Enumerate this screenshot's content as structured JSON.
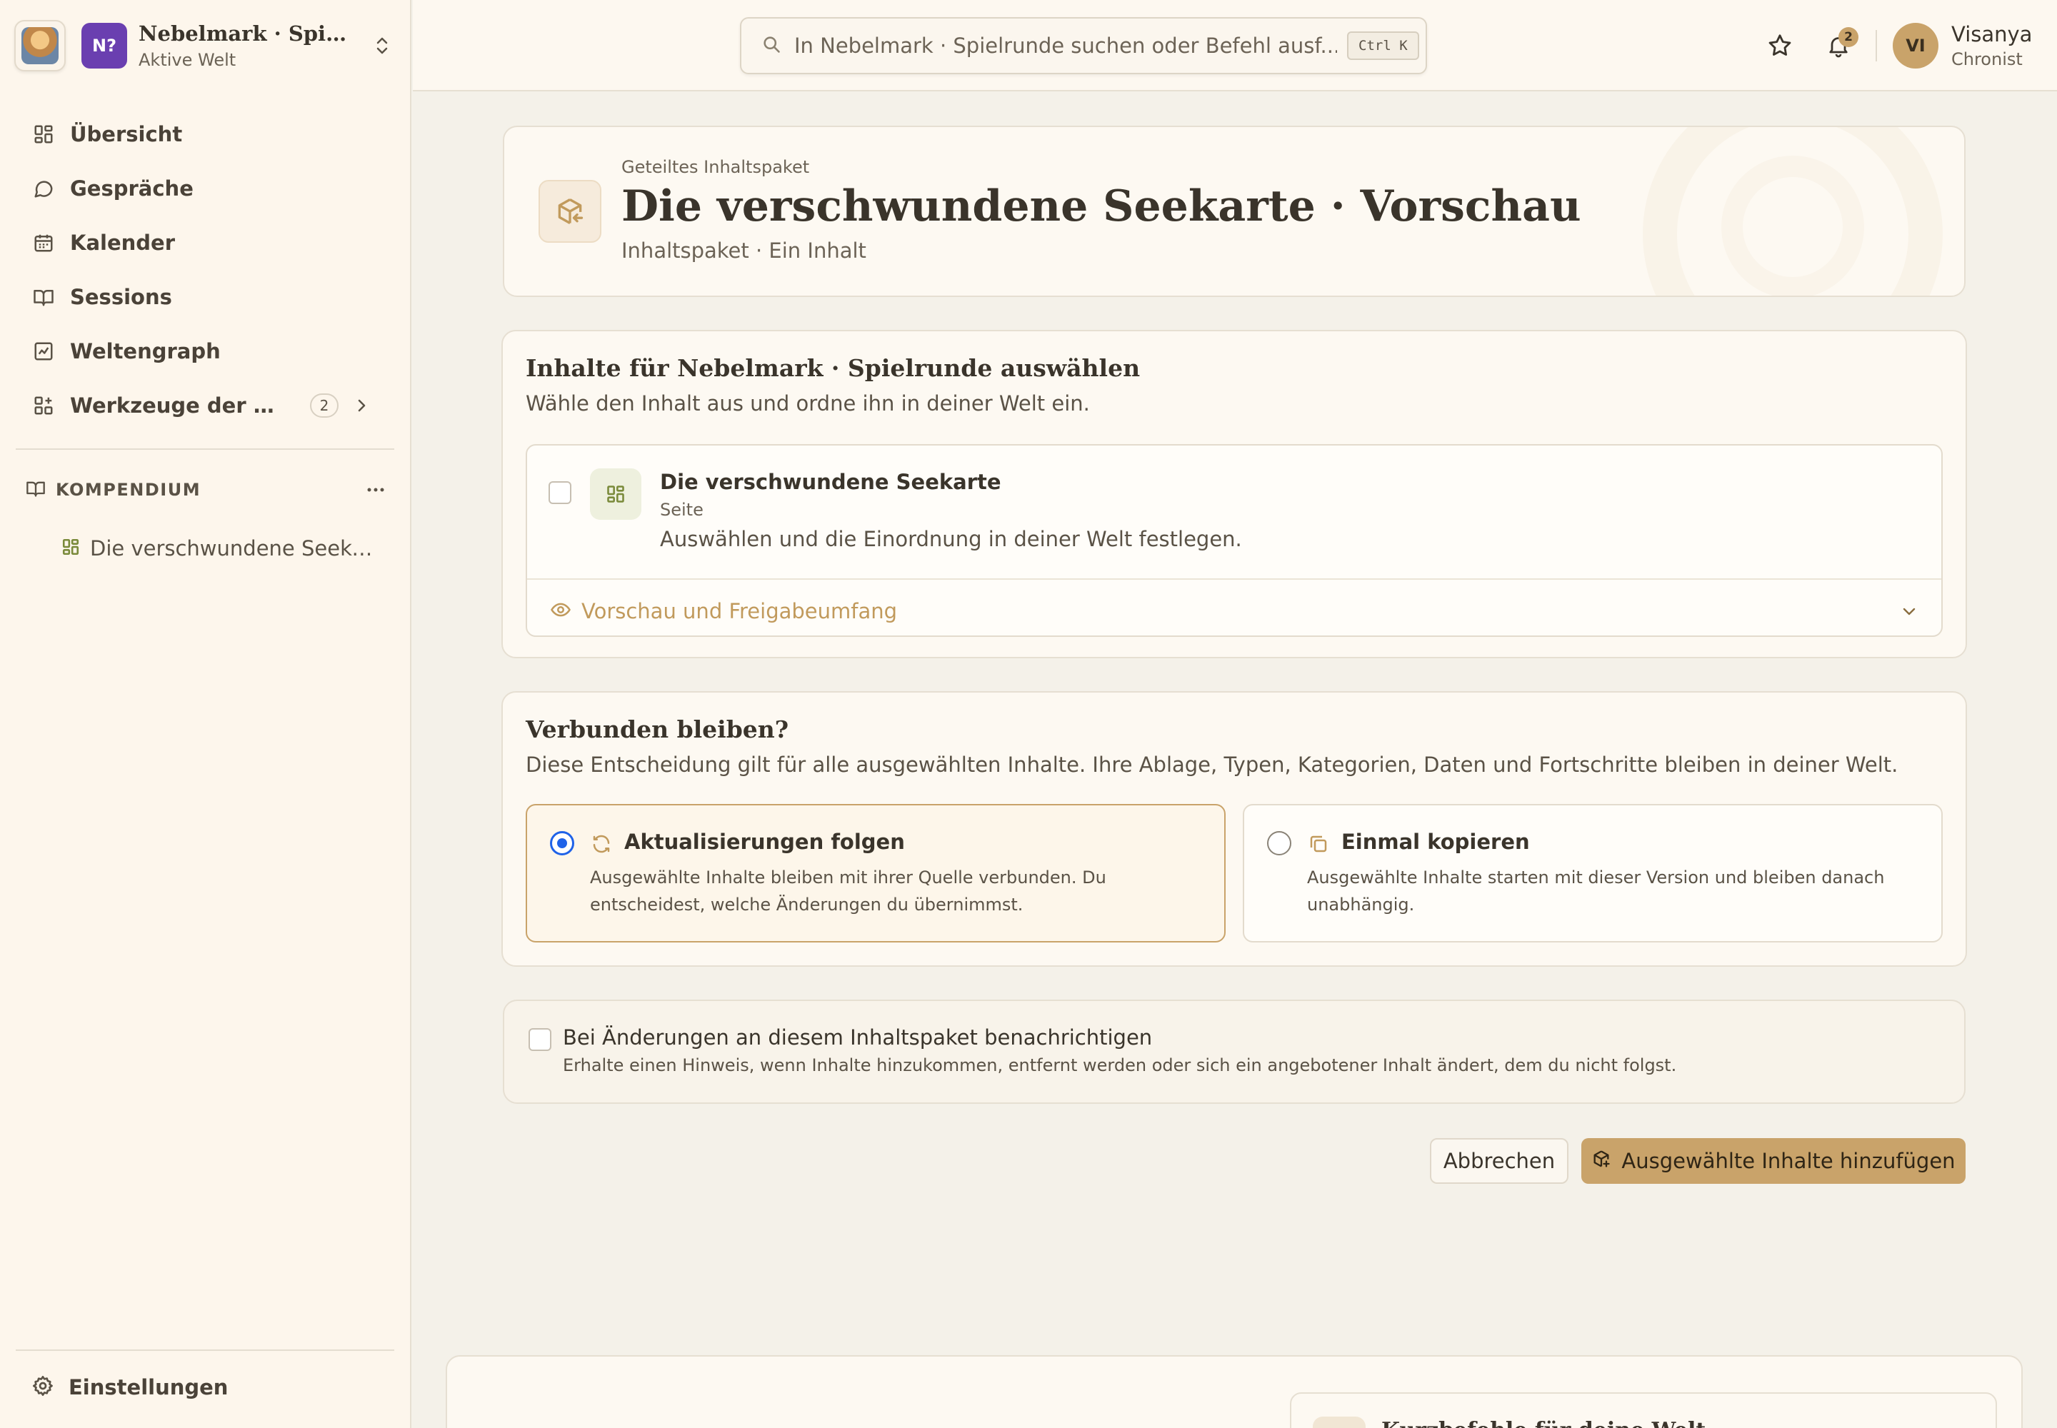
{
  "workspace": {
    "title": "Nebelmark · Spielrunde",
    "subtitle": "Aktive Welt",
    "badge": "N?"
  },
  "sidebar": {
    "items": [
      {
        "label": "Übersicht",
        "icon": "overview-grid-icon"
      },
      {
        "label": "Gespräche",
        "icon": "chat-bubble-icon"
      },
      {
        "label": "Kalender",
        "icon": "calendar-icon"
      },
      {
        "label": "Sessions",
        "icon": "open-book-icon"
      },
      {
        "label": "Weltengraph",
        "icon": "line-chart-icon"
      },
      {
        "label": "Werkzeuge der Welt",
        "icon": "tools-grid-plus-icon",
        "count": "2"
      }
    ],
    "compendium": {
      "label": "KOMPENDIUM",
      "items": [
        {
          "label": "Die verschwundene Seekarte"
        }
      ]
    },
    "settings_label": "Einstellungen"
  },
  "topbar": {
    "search_placeholder": "In Nebelmark · Spielrunde suchen oder Befehl ausf...",
    "shortcut": "Ctrl K",
    "notification_count": "2",
    "user": {
      "initials": "VI",
      "name": "Visanya",
      "role": "Chronist"
    }
  },
  "hero": {
    "kicker": "Geteiltes Inhaltspaket",
    "title": "Die verschwundene Seekarte · Vorschau",
    "subtitle": "Inhaltspaket · Ein Inhalt"
  },
  "selection": {
    "title": "Inhalte für Nebelmark · Spielrunde auswählen",
    "subtitle": "Wähle den Inhalt aus und ordne ihn in deiner Welt ein.",
    "item": {
      "title": "Die verschwundene Seekarte",
      "type": "Seite",
      "description": "Auswählen und die Einordnung in deiner Welt festlegen.",
      "checked": false
    },
    "preview_label": "Vorschau und Freigabeumfang"
  },
  "connection": {
    "title": "Verbunden bleiben?",
    "subtitle": "Diese Entscheidung gilt für alle ausgewählten Inhalte. Ihre Ablage, Typen, Kategorien, Daten und Fortschritte bleiben in deiner Welt.",
    "options": [
      {
        "title": "Aktualisierungen folgen",
        "description": "Ausgewählte Inhalte bleiben mit ihrer Quelle verbunden. Du entscheidest, welche Änderungen du übernimmst.",
        "selected": true
      },
      {
        "title": "Einmal kopieren",
        "description": "Ausgewählte Inhalte starten mit dieser Version und bleiben danach unabhängig.",
        "selected": false
      }
    ]
  },
  "notify": {
    "title": "Bei Änderungen an diesem Inhaltspaket benachrichtigen",
    "description": "Erhalte einen Hinweis, wenn Inhalte hinzukommen, entfernt werden oder sich ein angebotener Inhalt ändert, dem du nicht folgst.",
    "checked": false
  },
  "actions": {
    "cancel": "Abbrechen",
    "submit": "Ausgewählte Inhalte hinzufügen"
  },
  "bottom": {
    "title": "Kurzbefehle für deine Welt"
  },
  "colors": {
    "accent": "#c9a36a",
    "workspace_badge": "#6a3fb0",
    "radio_selected": "#1f62e8",
    "background": "#f4f1e9"
  }
}
